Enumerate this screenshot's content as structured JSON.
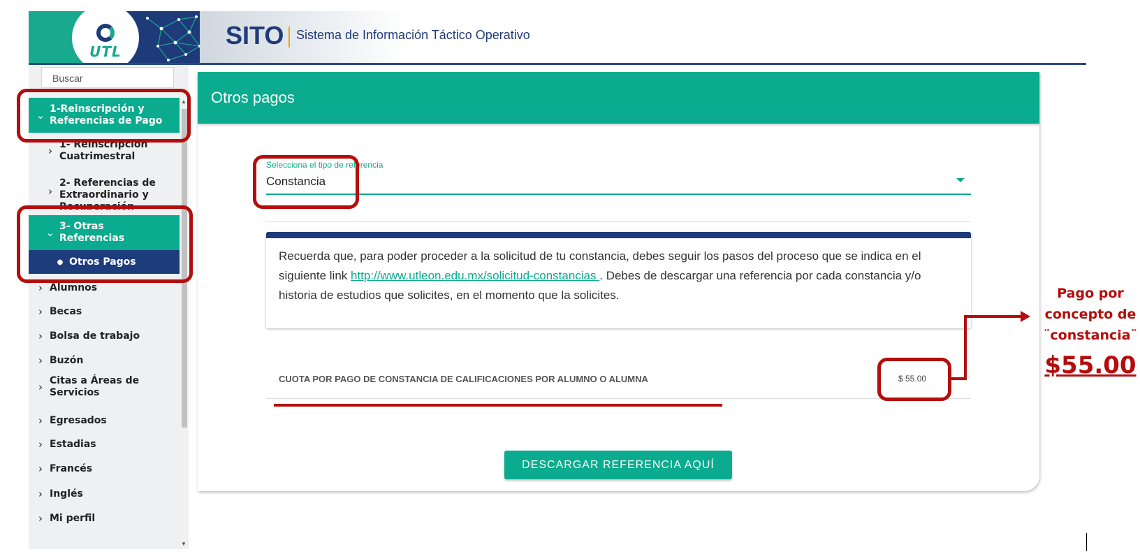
{
  "header": {
    "logo_text": "UTL",
    "brand": "SITO",
    "subtitle": "Sistema de Información Táctico Operativo"
  },
  "sidebar": {
    "search_placeholder": "Buscar",
    "items": [
      {
        "label_1": "1-Reinscripción y",
        "label_2": "Referencias de Pago"
      },
      {
        "label_1": "1- Reinscripción",
        "label_2": "Cuatrimestral"
      },
      {
        "label_1": "2- Referencias de",
        "label_2": "Extraordinario y",
        "label_3": "Recuperación"
      },
      {
        "label_1": "3- Otras",
        "label_2": "Referencias"
      },
      {
        "label": "Otros Pagos"
      },
      {
        "label": "Alumnos"
      },
      {
        "label": "Becas"
      },
      {
        "label": "Bolsa de trabajo"
      },
      {
        "label": "Buzón"
      },
      {
        "label_1": "Citas a Áreas de",
        "label_2": "Servicios"
      },
      {
        "label": "Egresados"
      },
      {
        "label": "Estadias"
      },
      {
        "label": "Francés"
      },
      {
        "label": "Inglés"
      },
      {
        "label": "Mi perfil"
      }
    ]
  },
  "main": {
    "title": "Otros pagos",
    "select": {
      "label": "Selecciona el tipo de referencia",
      "value": "Constancia"
    },
    "notice": {
      "text_before": "Recuerda que, para poder proceder a la solicitud de tu constancia, debes seguir los pasos del proceso que se indica en el siguiente link ",
      "link": "http://www.utleon.edu.mx/solicitud-constancias ",
      "text_after": ". Debes de descargar una referencia por cada constancia y/o historia de estudios que solicites, en el momento que la solicites."
    },
    "concept": "CUOTA POR PAGO DE CONSTANCIA DE CALIFICACIONES POR ALUMNO O ALUMNA",
    "amount": "$ 55.00",
    "download_button": "DESCARGAR REFERENCIA AQUÍ"
  },
  "annotation": {
    "line_1": "Pago por",
    "line_2": "concepto de",
    "line_3": "¨constancia¨",
    "price": "$55.00",
    "color": "#b50d0d"
  },
  "colors": {
    "accent": "#0aab8e",
    "navy": "#1e3a78"
  }
}
